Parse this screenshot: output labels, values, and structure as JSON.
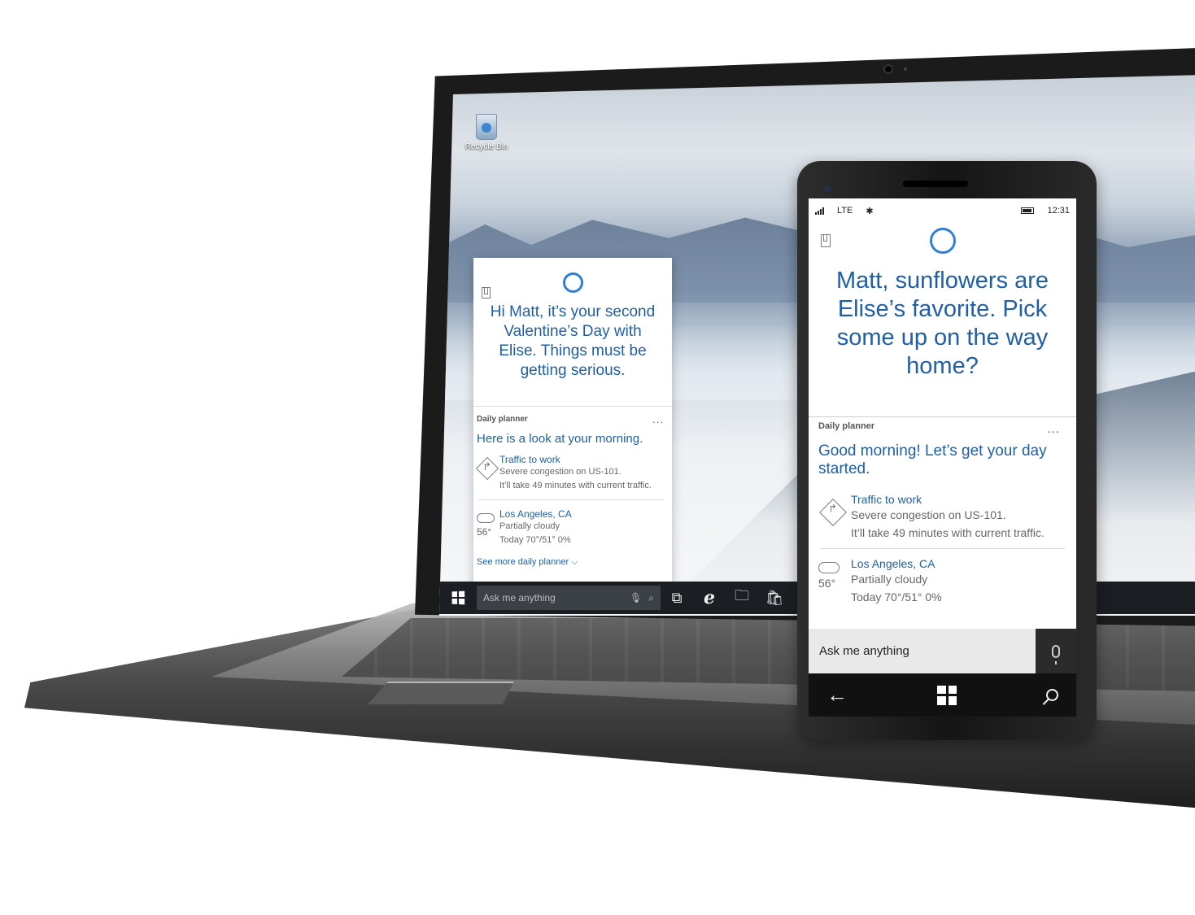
{
  "desktop": {
    "recycle_bin_label": "Recycle Bin"
  },
  "laptop_cortana": {
    "greeting": "Hi Matt, it’s your second Valentine’s Day with Elise. Things must be getting serious.",
    "planner_header": "Daily planner",
    "planner_more": "...",
    "planner_title": "Here is a look at your morning.",
    "traffic_title": "Traffic to work",
    "traffic_line1": "Severe congestion on US-101.",
    "traffic_line2": "It’ll take 49 minutes with current traffic.",
    "weather_city": "Los Angeles, CA",
    "weather_condition": "Partially cloudy",
    "weather_temp": "56°",
    "weather_today": "Today 70°/51° 0%",
    "see_more": "See more daily planner ⌵"
  },
  "taskbar": {
    "search_placeholder": "Ask me anything",
    "icons": [
      "windows-start",
      "microphone",
      "search",
      "task-view",
      "internet-explorer",
      "file-explorer",
      "store"
    ]
  },
  "phone": {
    "status": {
      "network": "LTE",
      "bluetooth": "✱",
      "time": "12:31"
    },
    "greeting": "Matt, sunflowers are Elise’s favorite. Pick some up on the way home?",
    "planner_header": "Daily planner",
    "planner_more": "...",
    "planner_title": "Good morning! Let’s get your day started.",
    "traffic_title": "Traffic to work",
    "traffic_line1": "Severe congestion on US-101.",
    "traffic_line2": "It’ll take 49 minutes with current traffic.",
    "weather_city": "Los Angeles, CA",
    "weather_condition": "Partially cloudy",
    "weather_temp": "56°",
    "weather_today": "Today 70°/51° 0%",
    "ask_placeholder": "Ask me anything",
    "nav_back": "←"
  },
  "colors": {
    "cortana_blue": "#1f5fa8",
    "cortana_ring": "#2f7fd6",
    "taskbar": "#1b1f24"
  }
}
